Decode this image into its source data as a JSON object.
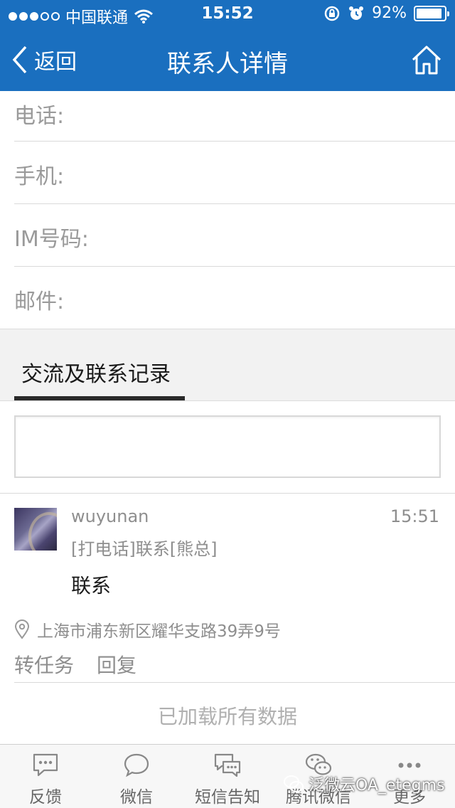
{
  "status_bar": {
    "carrier": "中国联通",
    "time": "15:52",
    "battery_percent": "92%",
    "battery_level": 0.92
  },
  "nav": {
    "back_label": "返回",
    "title": "联系人详情"
  },
  "fields": {
    "phone_label": "电话:",
    "mobile_label": "手机:",
    "im_label": "IM号码:",
    "email_label": "邮件:"
  },
  "section": {
    "tab_label": "交流及联系记录"
  },
  "post": {
    "user": "wuyunan",
    "time": "15:51",
    "tag": "[打电话]联系[熊总]",
    "content": "联系",
    "location": "上海市浦东新区耀华支路39弄9号",
    "actions": [
      "转任务",
      "回复"
    ]
  },
  "footer_note": "已加载所有数据",
  "tabbar": [
    {
      "label": "反馈",
      "icon": "feedback-icon"
    },
    {
      "label": "微信",
      "icon": "chat-bubble-icon"
    },
    {
      "label": "短信告知",
      "icon": "sms-icon"
    },
    {
      "label": "腾讯微信",
      "icon": "wechat-icon"
    },
    {
      "label": "更多",
      "icon": "more-icon"
    }
  ],
  "watermark": "泛微云OA_etegms",
  "colors": {
    "header_blue": "#1a6fbf",
    "divider": "#d9d9d9",
    "muted_text": "#8e8e8e"
  }
}
